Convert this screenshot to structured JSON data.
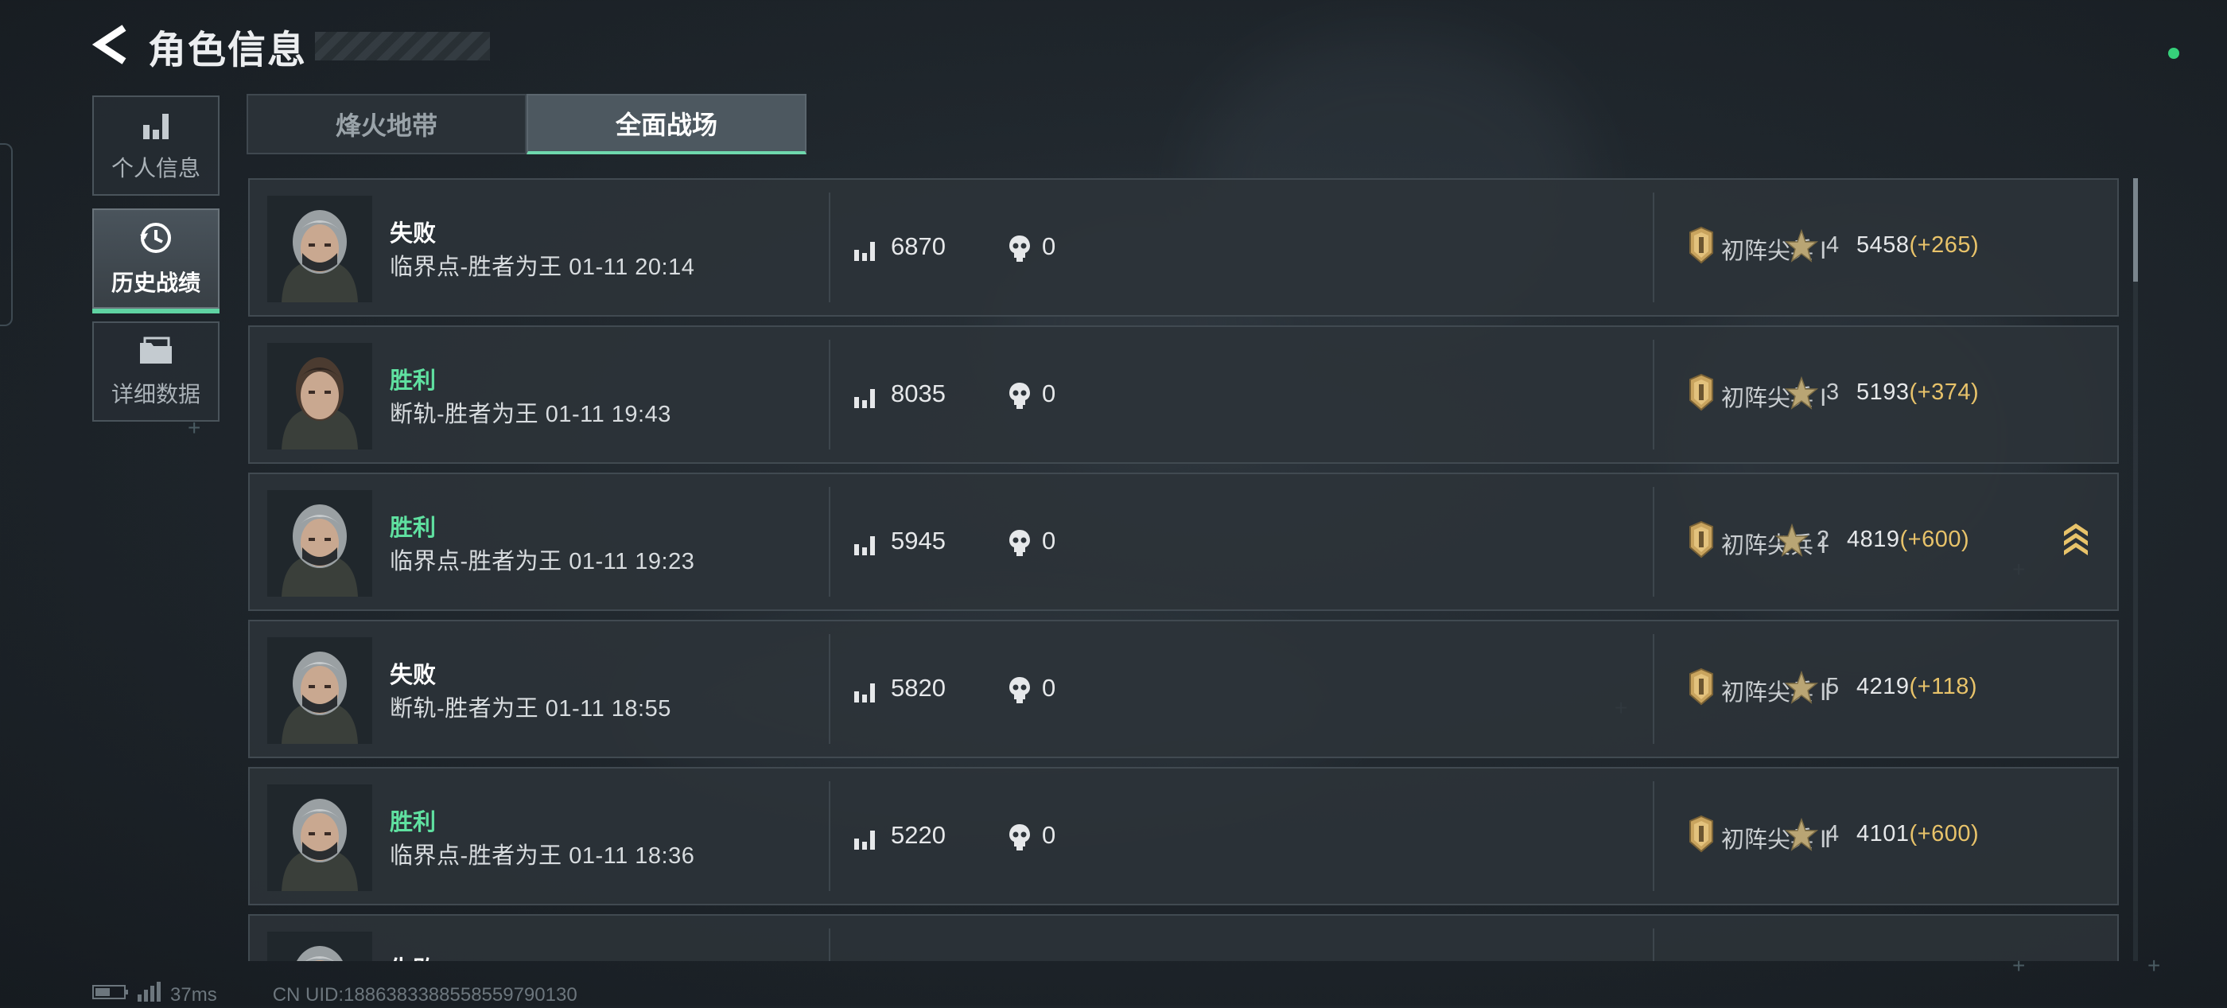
{
  "header": {
    "title": "角色信息"
  },
  "sidenav": {
    "items": [
      {
        "label": "个人信息",
        "icon": "bar-chart-icon",
        "active": false
      },
      {
        "label": "历史战绩",
        "icon": "history-clock-icon",
        "active": true
      },
      {
        "label": "详细数据",
        "icon": "folder-icon",
        "active": false
      }
    ]
  },
  "tabs": [
    {
      "label": "烽火地带",
      "active": false
    },
    {
      "label": "全面战场",
      "active": true
    }
  ],
  "matches": [
    {
      "result": "失败",
      "outcome": "lose",
      "map": "临界点-胜者为王 01-11 20:14",
      "score": "6870",
      "kills": "0",
      "rank": "初阵尖兵 Ⅰ",
      "stars": "4",
      "points": "5458",
      "delta": "(+265)",
      "promotion": false
    },
    {
      "result": "胜利",
      "outcome": "win",
      "map": "断轨-胜者为王 01-11 19:43",
      "score": "8035",
      "kills": "0",
      "rank": "初阵尖兵 Ⅰ",
      "stars": "3",
      "points": "5193",
      "delta": "(+374)",
      "promotion": false
    },
    {
      "result": "胜利",
      "outcome": "win",
      "map": "临界点-胜者为王 01-11 19:23",
      "score": "5945",
      "kills": "0",
      "rank": "初阵尖兵 Ⅰ",
      "stars": "2",
      "points": "4819",
      "delta": "(+600)",
      "promotion": true
    },
    {
      "result": "失败",
      "outcome": "lose",
      "map": "断轨-胜者为王 01-11 18:55",
      "score": "5820",
      "kills": "0",
      "rank": "初阵尖兵 Ⅱ",
      "stars": "5",
      "points": "4219",
      "delta": "(+118)",
      "promotion": false
    },
    {
      "result": "胜利",
      "outcome": "win",
      "map": "临界点-胜者为王 01-11 18:36",
      "score": "5220",
      "kills": "0",
      "rank": "初阵尖兵 Ⅱ",
      "stars": "4",
      "points": "4101",
      "delta": "(+600)",
      "promotion": false
    },
    {
      "result": "失败",
      "outcome": "lose",
      "map": "",
      "score": "",
      "kills": "",
      "rank": "",
      "stars": "",
      "points": "",
      "delta": "",
      "promotion": false
    }
  ],
  "footer": {
    "latency": "37ms",
    "uid": "CN UID:1886383388558559790130"
  },
  "colors": {
    "accent": "#6fd8ad",
    "win": "#5fe0a0",
    "delta": "#e8c36a",
    "status_dot": "#36d07a"
  }
}
